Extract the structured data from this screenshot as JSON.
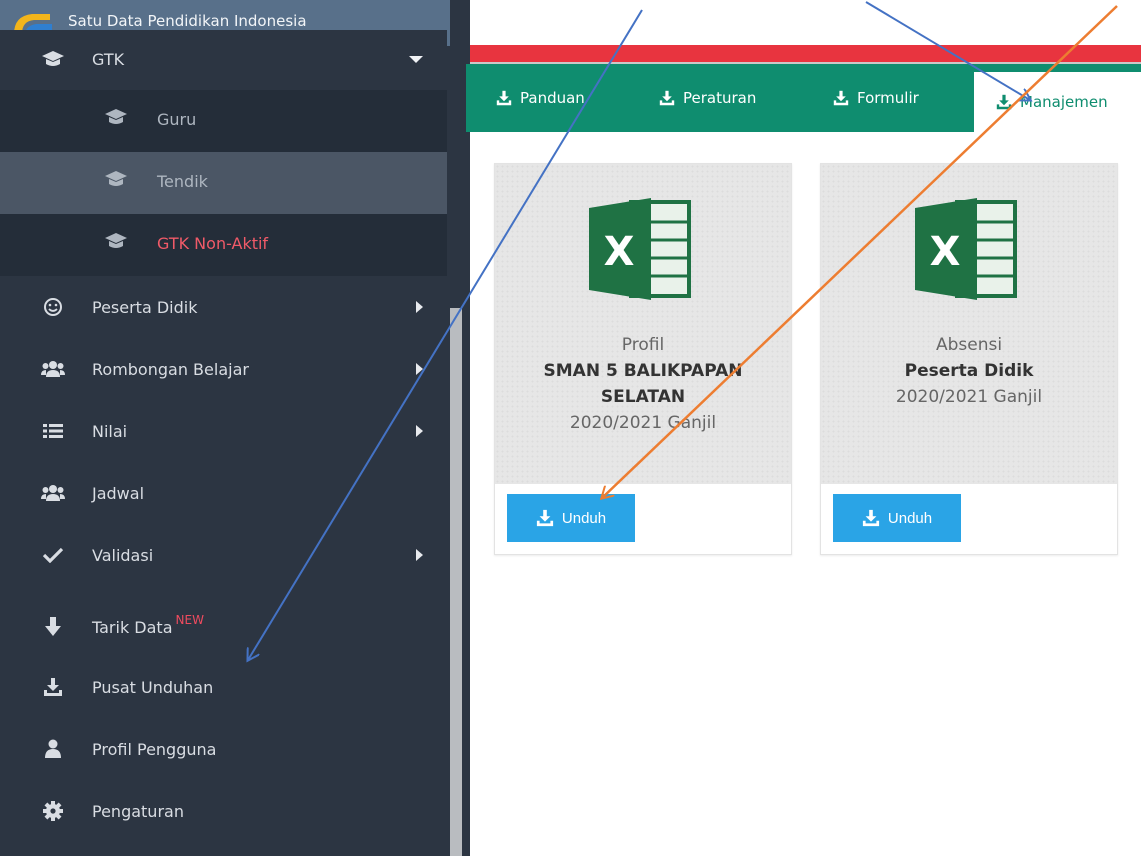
{
  "caption": {
    "text_prefix": "… Pusat Unduhan …",
    "bold_part": "Manajemen"
  },
  "brand": {
    "name": "Satu Data Pendidikan Indonesia"
  },
  "sidebar": {
    "gtk": {
      "label": "GTK"
    },
    "sub_items": [
      {
        "label": "Guru"
      },
      {
        "label": "Tendik"
      },
      {
        "label": "GTK Non-Aktif"
      }
    ],
    "items": [
      {
        "label": "Peserta Didik",
        "icon": "smile-icon"
      },
      {
        "label": "Rombongan Belajar",
        "icon": "users-icon"
      },
      {
        "label": "Nilai",
        "icon": "list-icon"
      },
      {
        "label": "Jadwal",
        "icon": "users-icon"
      },
      {
        "label": "Validasi",
        "icon": "check-icon"
      },
      {
        "label": "Tarik Data",
        "icon": "arrow-down-icon",
        "badge": "NEW"
      },
      {
        "label": "Pusat Unduhan",
        "icon": "download-icon"
      },
      {
        "label": "Profil Pengguna",
        "icon": "user-icon"
      },
      {
        "label": "Pengaturan",
        "icon": "gear-icon"
      }
    ]
  },
  "tabs": [
    {
      "label": "Panduan"
    },
    {
      "label": "Peraturan"
    },
    {
      "label": "Formulir"
    },
    {
      "label": "Manajemen"
    }
  ],
  "cards": [
    {
      "line1": "Profil",
      "line2": "SMAN 5 BALIKPAPAN",
      "line3": "SELATAN",
      "line4": "2020/2021 Ganjil",
      "button": "Unduh"
    },
    {
      "line1": "Absensi",
      "line2": "Peserta Didik",
      "line3": "2020/2021 Ganjil",
      "button": "Unduh"
    }
  ],
  "colors": {
    "sidebar_bg": "#2c3542",
    "tab_bar": "#0f8d6f",
    "button": "#2aa4e6",
    "alert": "#e8343f",
    "accent_red": "#f05a68"
  }
}
